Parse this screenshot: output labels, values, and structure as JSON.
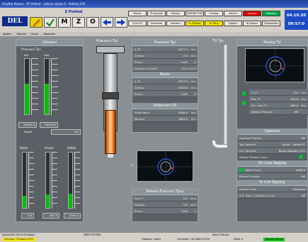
{
  "window": {
    "title": "VisuNet Alarms - PC Pohled - sdilena slozka 2 - Pohled_CPS"
  },
  "toolbar": {
    "screen_name": "Z Pohled",
    "buttons": [
      "M",
      "Z",
      "O"
    ],
    "nav_row1": [
      "Potoky",
      "Prumyslak",
      "Pohony",
      "VNITRNI POM",
      "Ovladac",
      "Aktivni",
      "Vykresy",
      "Pripojeni"
    ],
    "nav_row2": [
      "Vyvoj PC",
      "Schemata",
      "Navijeni",
      "Hl. Pohony",
      "Hl. Stroj",
      "Spojeni",
      "Hl.Spojeni",
      "Diagnostika"
    ],
    "clock_date": "04.10.20",
    "clock_time": "09:57:0"
  },
  "menu": {
    "items": [
      "Spojeni",
      "Obsluha",
      "Archiv",
      "Napoveda"
    ]
  },
  "zatizeni": {
    "title": "Zatizeni",
    "subtitle": "Pracovni Tyc",
    "col1": "Sila",
    "col2": "Disk",
    "val1": "20433.0",
    "val2": "20433.0",
    "rozdil_label": "Rozdil",
    "rozdil_value": "0.0",
    "klastr": "Klastr",
    "fixace": "Fixace",
    "odtah": "Odtah",
    "bottom1": "3.9",
    "bottom2": "561.0",
    "bottom3": "3164.0",
    "fills": [
      0.55,
      0.55,
      0.22,
      0.24,
      0.26
    ]
  },
  "pracovni_tyc_label": "Pracovni Tyc",
  "tv_tyc_label": "TV Tyc",
  "pracovni_panel": {
    "title": "Pracovni Tyc",
    "rows": [
      {
        "label": "Z_PT",
        "value": "3577.7",
        "unit": "mm"
      },
      {
        "label": "Zadana",
        "value": "0.0",
        "unit": "mm"
      },
      {
        "label": "Proud",
        "value": "0.00",
        "unit": "A"
      },
      {
        "label": "Aktualni rychlost",
        "value": "10.0",
        "unit": "mm/s"
      }
    ],
    "klastr_title": "Klastr",
    "klastr_rows": [
      {
        "label": "Z_KL",
        "value": "3577.2",
        "unit": "mm"
      },
      {
        "label": "Zadana",
        "value": "5216.0",
        "unit": "mm"
      },
      {
        "label": "Proud",
        "value": "0.00",
        "unit": "A"
      }
    ],
    "odlehceni_title": "Odlehceni SS",
    "odlehceni_rows": [
      {
        "label": "Vypocitana",
        "value": "4260.0",
        "unit": "mm"
      },
      {
        "label": "Merena",
        "value": "1894.2",
        "unit": "mm"
      }
    ],
    "rotace_title": "Rotace Pracovni Tyce",
    "rotace_rows": [
      {
        "label": "Rot_PT",
        "value": "-0.1",
        "unit": "stup"
      },
      {
        "label": "Zadana",
        "value": "0.0",
        "unit": "stup"
      },
      {
        "label": "Proud",
        "value": "3.94",
        "unit": "A"
      }
    ]
  },
  "polohy_panel": {
    "title": "Polohy TV",
    "rows": [
      {
        "label": "Z_TV",
        "value": "0.0",
        "unit": "mm"
      },
      {
        "label": "Rot_TV",
        "value": "319.0",
        "unit": "stup"
      },
      {
        "label": "Pol. Uhel TV",
        "value": "180.0",
        "unit": "stup"
      },
      {
        "label": "Rotace Provozni",
        "value": "NE",
        "unit": ""
      }
    ],
    "operace_title": "Operace",
    "operace_rows": [
      {
        "label": "Operace Probiha",
        "value": "NE"
      },
      {
        "label": "Typ Operace",
        "value": "MOVE - Pohyb PT"
      },
      {
        "label": "Pol. Operace",
        "value": "Rucni ovladani z PC"
      }
    ],
    "polohy_pt_label": "Polsha Pracovni Tyce",
    "online_title": "On Line Sipping",
    "online_rows": [
      {
        "label": "Doba Trvani",
        "value": "4260.0"
      },
      {
        "label": "Mereni Probiha",
        "value": "NE"
      }
    ],
    "incell_title": "In Cell Sipping",
    "incell_rows": [
      {
        "label": "Poloha Vzrku",
        "value": "Otevrena"
      },
      {
        "label": "Z.S. Nevr v Odtahu in Cell",
        "value": "NE"
      }
    ]
  },
  "scope_left": {
    "label": "0"
  },
  "status": {
    "date": "04/10/2007 09:53:20 Admin",
    "mode": "DMER POHYBU",
    "center": "Hlavni Pohyby",
    "row2_left": "Ochrana - Pripojeni k PLC",
    "row2_mid": "Obsazeni: zadne",
    "row2_pc": "Computer: 192.168.0.47/99",
    "row2_mode": "Mode: 0",
    "row2_right": "Zprava: Bezna"
  }
}
